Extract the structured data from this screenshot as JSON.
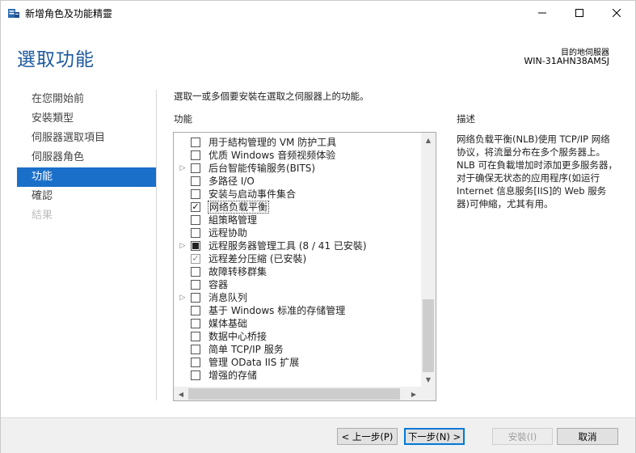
{
  "window": {
    "title": "新增角色及功能精靈",
    "minimize_icon": "minimize-icon",
    "maximize_icon": "maximize-icon",
    "close_icon": "close-icon"
  },
  "header": {
    "title": "選取功能",
    "dest_label": "目的地伺服器",
    "dest_server": "WIN-31AHN38AMSJ"
  },
  "nav": {
    "items": [
      {
        "label": "在您開始前",
        "state": "normal"
      },
      {
        "label": "安裝類型",
        "state": "normal"
      },
      {
        "label": "伺服器選取項目",
        "state": "normal"
      },
      {
        "label": "伺服器角色",
        "state": "normal"
      },
      {
        "label": "功能",
        "state": "active"
      },
      {
        "label": "確認",
        "state": "normal"
      },
      {
        "label": "結果",
        "state": "disabled"
      }
    ]
  },
  "main": {
    "intro": "選取一或多個要安裝在選取之伺服器上的功能。",
    "features_label": "功能",
    "features": [
      {
        "label": "用于結构管理的 VM 防护工具",
        "state": "unchecked",
        "expandable": false
      },
      {
        "label": "优质 Windows 音频视频体验",
        "state": "unchecked",
        "expandable": false
      },
      {
        "label": "后台智能传输服务(BITS)",
        "state": "unchecked",
        "expandable": true
      },
      {
        "label": "多路径 I/O",
        "state": "unchecked",
        "expandable": false
      },
      {
        "label": "安装与启动事件集合",
        "state": "unchecked",
        "expandable": false
      },
      {
        "label": "网络负载平衡",
        "state": "checked",
        "expandable": false,
        "selected": true
      },
      {
        "label": "組策略管理",
        "state": "unchecked",
        "expandable": false
      },
      {
        "label": "远程协助",
        "state": "unchecked",
        "expandable": false
      },
      {
        "label": "远程服务器管理工具 (8 / 41 已安裝)",
        "state": "partial",
        "expandable": true
      },
      {
        "label": "远程差分压縮 (已安裝)",
        "state": "installed",
        "expandable": false
      },
      {
        "label": "故障转移群集",
        "state": "unchecked",
        "expandable": false
      },
      {
        "label": "容器",
        "state": "unchecked",
        "expandable": false
      },
      {
        "label": "消息队列",
        "state": "unchecked",
        "expandable": true
      },
      {
        "label": "基于 Windows 标准的存储管理",
        "state": "unchecked",
        "expandable": false
      },
      {
        "label": "媒体基础",
        "state": "unchecked",
        "expandable": false
      },
      {
        "label": "数据中心桥接",
        "state": "unchecked",
        "expandable": false
      },
      {
        "label": "简单 TCP/IP 服务",
        "state": "unchecked",
        "expandable": false
      },
      {
        "label": "管理 OData IIS 扩展",
        "state": "unchecked",
        "expandable": false
      },
      {
        "label": "增强的存储",
        "state": "unchecked",
        "expandable": false
      }
    ],
    "description_label": "描述",
    "description": "网络负载平衡(NLB)使用 TCP/IP 网络协议，将流量分布在多个服务器上。NLB 可在負載增加时添加更多服务器，对于确保无状态的应用程序(如运行 Internet 信息服务[IIS]的 Web 服务器)可伸縮，尤其有用。"
  },
  "footer": {
    "prev_label": "< 上一步(P)",
    "next_label": "下一步(N) >",
    "install_label": "安裝(I)",
    "cancel_label": "取消"
  }
}
